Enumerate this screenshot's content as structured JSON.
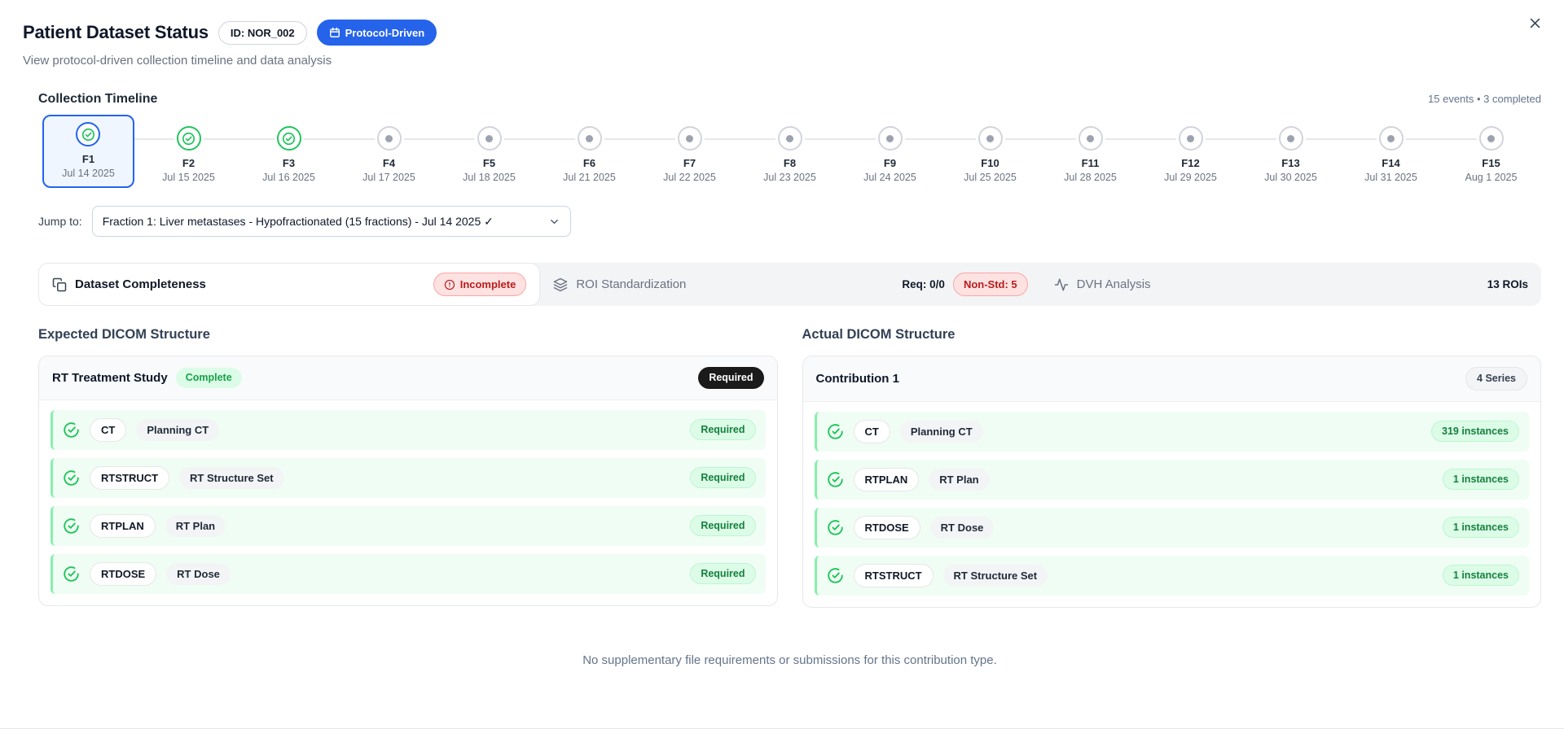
{
  "window": {
    "close_label": "close"
  },
  "header": {
    "title": "Patient Dataset Status",
    "id_badge": "ID: NOR_002",
    "protocol_badge": "Protocol-Driven",
    "subtitle": "View protocol-driven collection timeline and data analysis"
  },
  "timeline": {
    "title": "Collection Timeline",
    "summary": "15 events • 3 completed",
    "jump_label": "Jump to:",
    "jump_selected": "Fraction 1: Liver metastases - Hypofractionated (15 fractions) - Jul 14 2025 ✓",
    "events": [
      {
        "label": "F1",
        "date": "Jul 14 2025",
        "status": "completed",
        "selected": true
      },
      {
        "label": "F2",
        "date": "Jul 15 2025",
        "status": "completed",
        "selected": false
      },
      {
        "label": "F3",
        "date": "Jul 16 2025",
        "status": "completed",
        "selected": false
      },
      {
        "label": "F4",
        "date": "Jul 17 2025",
        "status": "pending",
        "selected": false
      },
      {
        "label": "F5",
        "date": "Jul 18 2025",
        "status": "pending",
        "selected": false
      },
      {
        "label": "F6",
        "date": "Jul 21 2025",
        "status": "pending",
        "selected": false
      },
      {
        "label": "F7",
        "date": "Jul 22 2025",
        "status": "pending",
        "selected": false
      },
      {
        "label": "F8",
        "date": "Jul 23 2025",
        "status": "pending",
        "selected": false
      },
      {
        "label": "F9",
        "date": "Jul 24 2025",
        "status": "pending",
        "selected": false
      },
      {
        "label": "F10",
        "date": "Jul 25 2025",
        "status": "pending",
        "selected": false
      },
      {
        "label": "F11",
        "date": "Jul 28 2025",
        "status": "pending",
        "selected": false
      },
      {
        "label": "F12",
        "date": "Jul 29 2025",
        "status": "pending",
        "selected": false
      },
      {
        "label": "F13",
        "date": "Jul 30 2025",
        "status": "pending",
        "selected": false
      },
      {
        "label": "F14",
        "date": "Jul 31 2025",
        "status": "pending",
        "selected": false
      },
      {
        "label": "F15",
        "date": "Aug 1 2025",
        "status": "pending",
        "selected": false
      }
    ]
  },
  "status_bar": {
    "dataset_completeness": {
      "label": "Dataset Completeness",
      "badge": "Incomplete"
    },
    "roi_standardization": {
      "label": "ROI Standardization",
      "req": "Req: 0/0",
      "badge": "Non-Std: 5"
    },
    "dvh_analysis": {
      "label": "DVH Analysis",
      "count": "13 ROIs"
    }
  },
  "expected": {
    "heading": "Expected DICOM Structure",
    "panel_title": "RT Treatment Study",
    "panel_status": "Complete",
    "panel_tag": "Required",
    "rows": [
      {
        "modality": "CT",
        "description": "Planning CT",
        "badge": "Required"
      },
      {
        "modality": "RTSTRUCT",
        "description": "RT Structure Set",
        "badge": "Required"
      },
      {
        "modality": "RTPLAN",
        "description": "RT Plan",
        "badge": "Required"
      },
      {
        "modality": "RTDOSE",
        "description": "RT Dose",
        "badge": "Required"
      }
    ]
  },
  "actual": {
    "heading": "Actual DICOM Structure",
    "panel_title": "Contribution 1",
    "panel_tag": "4 Series",
    "rows": [
      {
        "modality": "CT",
        "description": "Planning CT",
        "badge": "319 instances"
      },
      {
        "modality": "RTPLAN",
        "description": "RT Plan",
        "badge": "1 instances"
      },
      {
        "modality": "RTDOSE",
        "description": "RT Dose",
        "badge": "1 instances"
      },
      {
        "modality": "RTSTRUCT",
        "description": "RT Structure Set",
        "badge": "1 instances"
      }
    ]
  },
  "footer": {
    "note": "No supplementary file requirements or submissions for this contribution type."
  },
  "colors": {
    "accent_blue": "#2563eb",
    "success_green": "#22c55e",
    "success_bg": "#dcfce7",
    "row_green_bg": "#f0fdf4",
    "error_red": "#b91c1c",
    "error_bg": "#fee2e2",
    "dark_pill": "#1a1a1a"
  }
}
